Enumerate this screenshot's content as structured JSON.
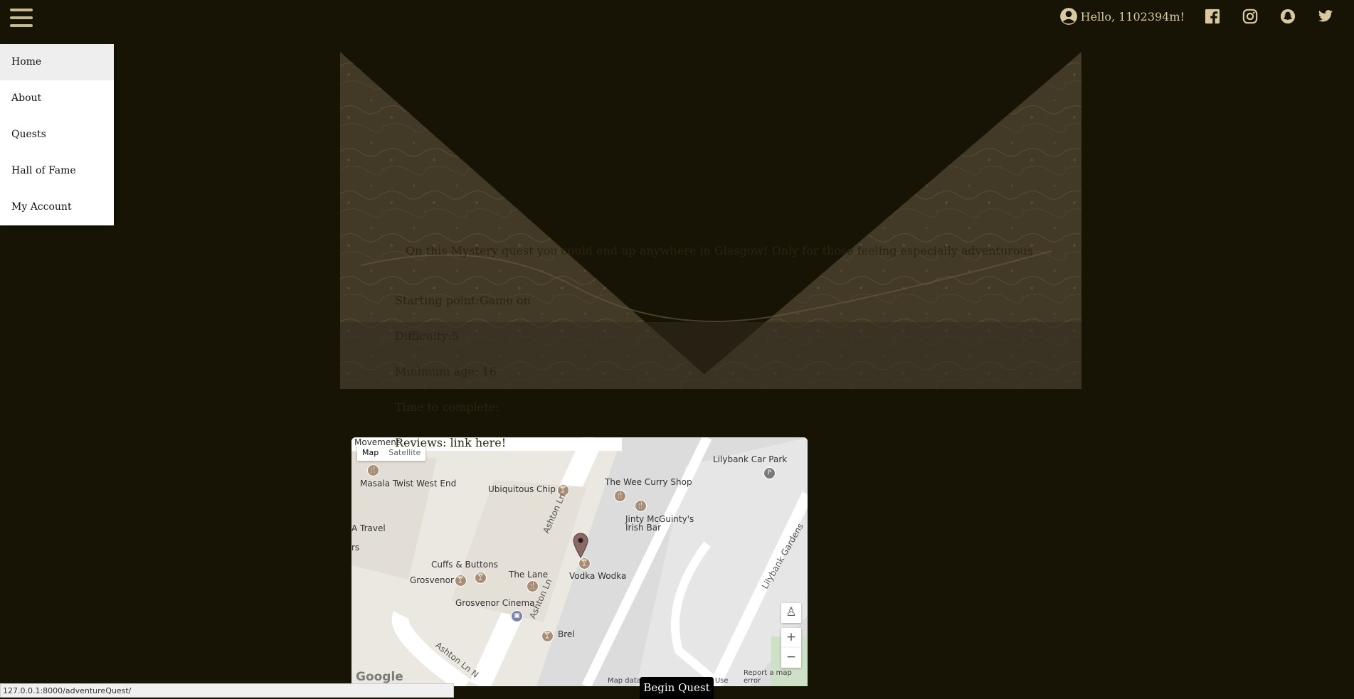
{
  "header": {
    "greeting": "Hello, 1102394m!",
    "social_icons": [
      "facebook-icon",
      "instagram-icon",
      "snapchat-icon",
      "twitter-icon"
    ]
  },
  "menu": {
    "items": [
      "Home",
      "About",
      "Quests",
      "Hall of Fame",
      "My Account"
    ],
    "active": "Home"
  },
  "quest": {
    "description": "On this Mystery quest you could end up anywhere in Glasgow! Only for those feeling especially adventurous",
    "starting_point": "Starting point:Game on",
    "difficulty": "Difficulty:5",
    "minimum_age": "Minimum age: 16",
    "time_to_complete": "Time to complete:",
    "reviews": "Reviews: link here!",
    "begin_label": "Begin Quest"
  },
  "map": {
    "type_map": "Map",
    "type_satellite": "Satellite",
    "zoom_in": "+",
    "zoom_out": "−",
    "labels": {
      "movement": "Movement",
      "masala": "Masala Twist West End",
      "chip": "Ubiquitous Chip",
      "curry": "The Wee Curry Shop",
      "carpark": "Lilybank Car Park",
      "jinty": "Jinty McGuinty's",
      "irish": "Irish Bar",
      "travel": "A Travel",
      "rs": "rs",
      "cuffs": "Cuffs & Buttons",
      "grosvenor": "Grosvenor",
      "lane": "The Lane",
      "vodka": "Vodka Wodka",
      "cinema": "Grosvenor Cinema",
      "brel": "Brel",
      "ashton1": "Ashton Ln",
      "ashton2": "Ashton Ln",
      "ashton3": "Ashton Ln N",
      "lilygardens": "Lilybank Gardens"
    },
    "google": "Google",
    "map_data": "Map data",
    "terms": "of Use",
    "report": "Report a map error"
  },
  "status_url": "127.0.0.1:8000/adventureQuest/",
  "colors": {
    "background": "#171305",
    "accent": "#c9b98f"
  }
}
